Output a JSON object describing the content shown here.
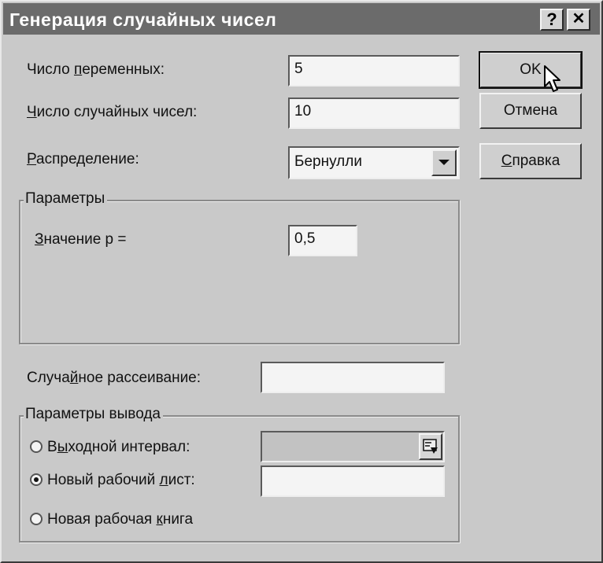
{
  "window": {
    "title": "Генерация случайных чисел",
    "help_glyph": "?",
    "close_glyph": "✕"
  },
  "fields": {
    "num_variables": {
      "label_prefix": "Число ",
      "label_key": "п",
      "label_rest": "еременных:",
      "value": "5"
    },
    "num_random": {
      "label_key": "Ч",
      "label_rest": "исло случайных чисел:",
      "value": "10"
    },
    "distribution": {
      "label_key": "Р",
      "label_rest": "аспределение:",
      "value": "Бернулли"
    },
    "random_seed": {
      "label_prefix": "Случа",
      "label_key": "й",
      "label_rest": "ное рассеивание:",
      "value": ""
    }
  },
  "params_group": {
    "title": "Параметры",
    "p_value": {
      "label_key": "З",
      "label_rest": "начение p =",
      "value": "0,5"
    }
  },
  "output_group": {
    "title": "Параметры вывода",
    "output_range": {
      "label_prefix": "В",
      "label_key": "ы",
      "label_rest": "ходной интервал:",
      "value": "",
      "selected": false
    },
    "new_sheet": {
      "label_prefix": "Новый рабочий ",
      "label_key": "л",
      "label_rest": "ист:",
      "value": "",
      "selected": true
    },
    "new_book": {
      "label_prefix": "Новая рабочая ",
      "label_key": "к",
      "label_rest": "нига",
      "selected": false
    }
  },
  "buttons": {
    "ok": "OK",
    "cancel": "Отмена",
    "help_key": "С",
    "help_rest": "правка"
  },
  "icons": {
    "collapse_dialog": "collapse-dialog-icon",
    "cursor": "mouse-pointer-icon",
    "dropdown": "dropdown-arrow-icon"
  }
}
